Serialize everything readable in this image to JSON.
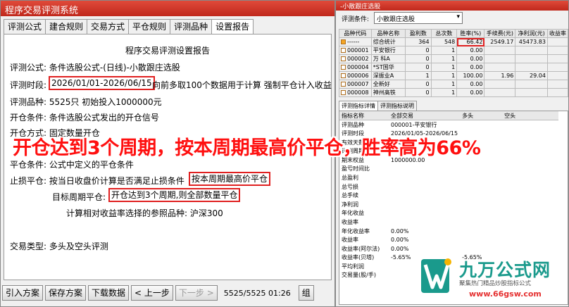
{
  "left_window": {
    "title": "程序交易评测系统",
    "tabs": [
      "评测公式",
      "建合规则",
      "交易方式",
      "平仓规则",
      "评测品种",
      "设置报告"
    ],
    "report": {
      "title": "程序交易评测设置报告",
      "formula_label": "评测公式:",
      "formula_value": "条件选股公式-(日线)-小散跟庄选股",
      "period_label": "评测时段:",
      "period_value": "2026/01/01-2026/06/15",
      "period_tail": "向前多取100个数据用于计算 强制平仓计入收益",
      "variety_line": "评测品种: 5525只 初始投入1000000元",
      "open_line": "开仓条件: 条件选股公式发出的开仓信号",
      "method_line": "开仓方式: 固定数量开仓",
      "close_line": "平仓条件: 公式中定义的平仓条件",
      "stoploss_label": "止损平仓: 按当日收盘价计算是否满足止损条件",
      "stoploss_hl": "按本周期最高价平仓",
      "target_label": "目标周期平仓:",
      "target_hl": "开仓达到3个周期,则全部数量平仓",
      "bench_line": "计算相对收益率选择的参照品种: 沪深300",
      "type_line": "交易类型: 多头及空头评测"
    },
    "buttons": {
      "import": "引入方案",
      "save": "保存方案",
      "download": "下载数据",
      "prev": "< 上一步",
      "next": "下一步 >",
      "pager": "5525/5525 01:26",
      "extra": "组"
    }
  },
  "right_window": {
    "title": "-小散跟庄选股",
    "filter_label": "评测条件:",
    "filter_value": "小散跟庄选股",
    "columns": [
      "品种代码",
      "品种名称",
      "盈利数",
      "总次数",
      "胜率(%)",
      "手续费(元)",
      "净利润(元)",
      "收益率"
    ],
    "rows": [
      [
        "------",
        "综合统计",
        "364",
        "548",
        "66.42",
        "2549.17",
        "45473.83",
        ""
      ],
      [
        "000001",
        "平安银行",
        "0",
        "1",
        "0.00",
        "",
        "",
        ""
      ],
      [
        "000002",
        "万 科A",
        "0",
        "1",
        "0.00",
        "",
        "",
        ""
      ],
      [
        "000004",
        "*ST国华",
        "0",
        "1",
        "0.00",
        "",
        "",
        ""
      ],
      [
        "000006",
        "深振业A",
        "1",
        "1",
        "100.00",
        "1.96",
        "29.04",
        ""
      ],
      [
        "000007",
        "全新好",
        "0",
        "1",
        "0.00",
        "",
        "",
        ""
      ],
      [
        "000008",
        "神州高铁",
        "0",
        "1",
        "0.00",
        "",
        "",
        ""
      ]
    ],
    "detail_tabs": [
      "评测指标详情",
      "评测指标说明"
    ],
    "detail_columns": [
      "指标名称",
      "全部交易",
      "多头",
      "空头"
    ],
    "detail_rows": [
      [
        "评测品种",
        "000001-平安银行",
        "",
        ""
      ],
      [
        "评测时段",
        "2026/01/05-2026/06/15",
        "",
        ""
      ],
      [
        "有效天数",
        "162",
        "",
        ""
      ],
      [
        "评测周期数",
        "206",
        "",
        ""
      ],
      [
        "期末权益",
        "1000000.00",
        "",
        ""
      ],
      [
        "盈亏时间比",
        "",
        "",
        ""
      ],
      [
        "总盈利",
        "",
        "",
        ""
      ],
      [
        "总亏损",
        "",
        "",
        ""
      ],
      [
        "总手续",
        "",
        "",
        ""
      ],
      [
        "净利润",
        "",
        "",
        ""
      ],
      [
        "年化收益",
        "",
        "",
        ""
      ],
      [
        "收益率",
        "",
        "",
        ""
      ],
      [
        "年化收益率",
        "0.00%",
        "",
        ""
      ],
      [
        "收益率",
        "0.00%",
        "",
        ""
      ],
      [
        "收益率(阿尔法)",
        "0.00%",
        "",
        ""
      ],
      [
        "收益率(贝塔)",
        "-5.65%",
        "-5.65%",
        ""
      ],
      [
        "平均利润",
        "",
        "",
        ""
      ],
      [
        "交易量(股/手)",
        "",
        "",
        ""
      ]
    ]
  },
  "banner": "开仓达到3个周期，按本周期最高价平仓，胜率高为66%",
  "logo": {
    "name": "九万公式网",
    "sub": "聚集热门精品炒股指标公式",
    "url": "www.66gsw.com"
  },
  "colors": {
    "title_bar": "#d0342a",
    "highlight_box": "#e02020",
    "banner": "#ff1010",
    "logo": "#1a9a8c"
  }
}
